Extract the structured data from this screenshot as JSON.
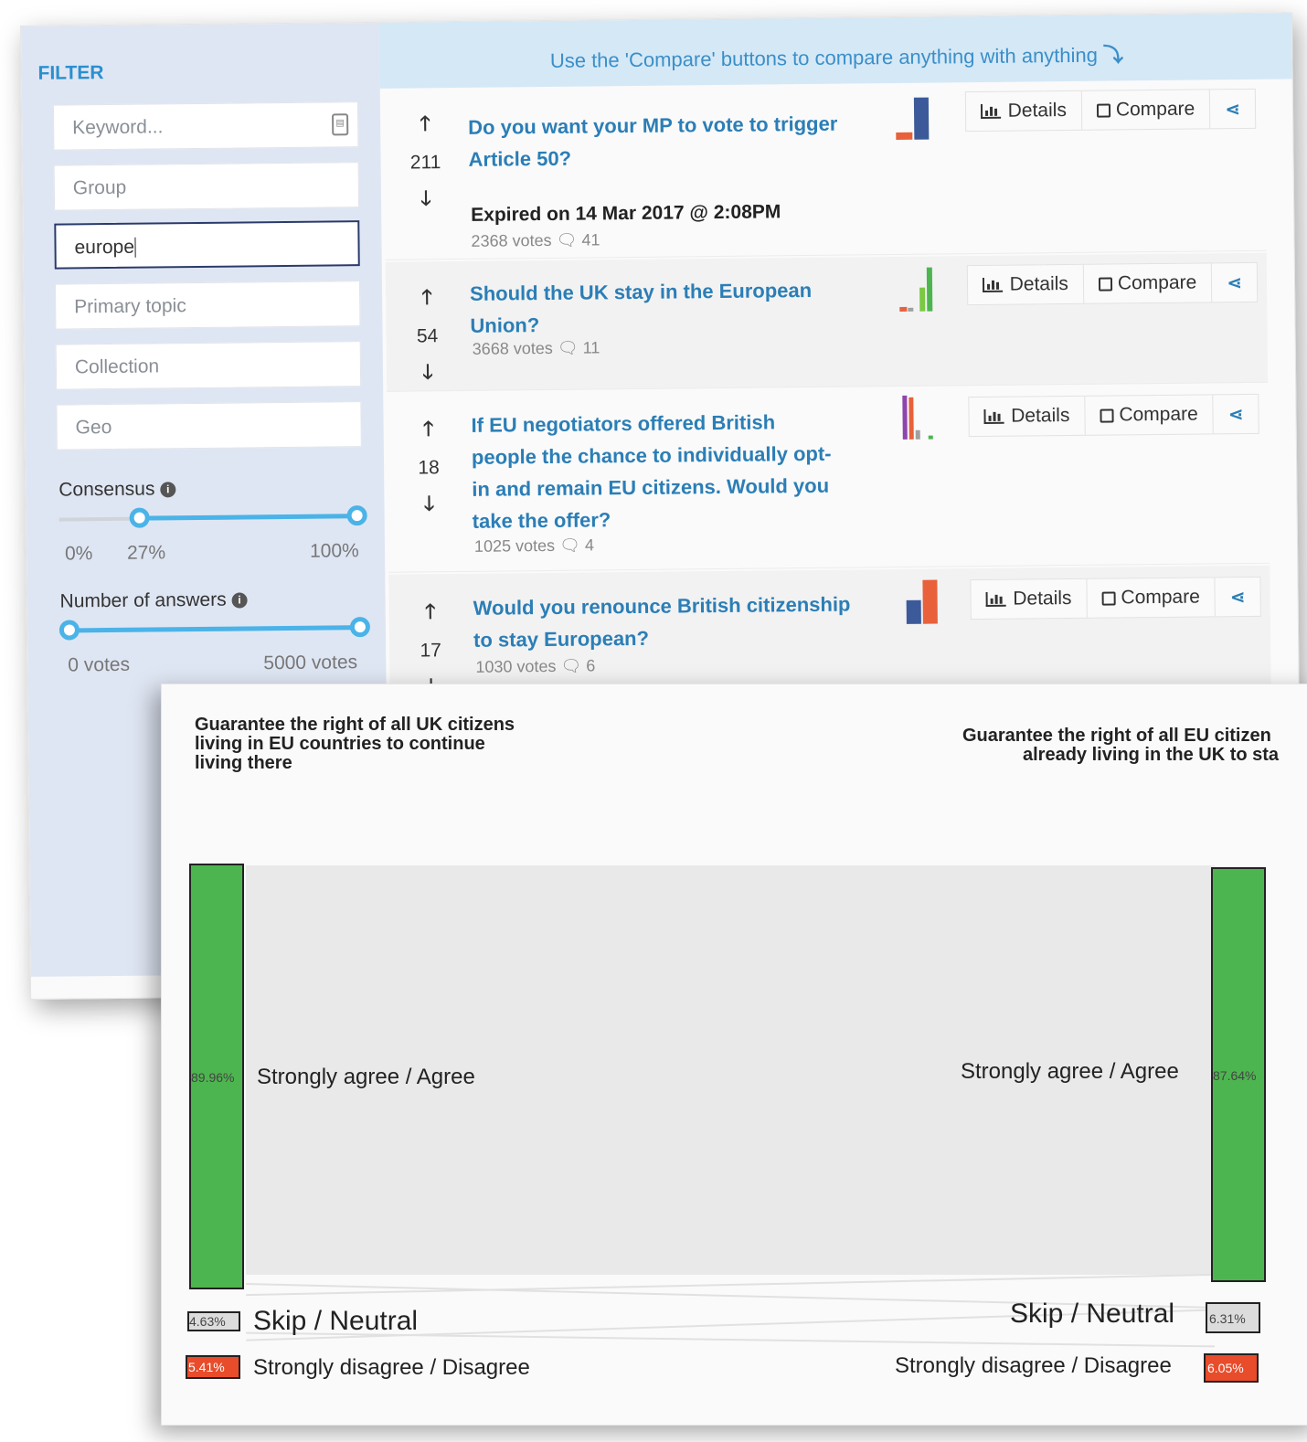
{
  "filter": {
    "title": "FILTER",
    "keyword_placeholder": "Keyword...",
    "group_placeholder": "Group",
    "search_value": "europe",
    "primary_topic_placeholder": "Primary topic",
    "collection_placeholder": "Collection",
    "geo_placeholder": "Geo",
    "consensus": {
      "label": "Consensus",
      "info_icon": "info-icon",
      "tick_min": "0%",
      "tick_low": "27%",
      "tick_max": "100%",
      "value_low": 27,
      "value_high": 100
    },
    "answers": {
      "label": "Number of answers",
      "info_icon": "info-icon",
      "tick_min": "0 votes",
      "tick_max": "5000 votes",
      "value_low": 0,
      "value_high": 5000
    }
  },
  "banner": {
    "text": "Use the 'Compare' buttons to compare anything with anything",
    "icon": "curved-arrow-down-icon",
    "arrow": "⤵"
  },
  "buttons": {
    "details": "Details",
    "compare": "Compare",
    "share_icon": "share-icon"
  },
  "questions": [
    {
      "score": "211",
      "title_line1": "Do you want your MP to vote to trigger",
      "title_line2": "Article 50?",
      "expired": "Expired on 14 Mar 2017 @ 2:08PM",
      "votes": "2368 votes",
      "comments": "41",
      "spark_colors": [
        "#e8613a",
        "#3c5a9a"
      ]
    },
    {
      "score": "54",
      "title_line1": "Should the UK stay in the European",
      "title_line2": "Union?",
      "votes": "3668 votes",
      "comments": "11",
      "spark_colors": [
        "#e8613a",
        "#a0a0a0",
        "#7ac943",
        "#4db54f"
      ]
    },
    {
      "score": "18",
      "title_line1": "If EU negotiators offered British",
      "title_line2": "people the chance to individually opt-",
      "title_line3": "in and remain EU citizens. Would you",
      "title_line4": "take the offer?",
      "votes": "1025 votes",
      "comments": "4",
      "spark_colors": [
        "#8e44ad",
        "#e8613a",
        "#a0a0a0",
        "#4db54f"
      ]
    },
    {
      "score": "17",
      "title_line1": "Would you renounce British citizenship",
      "title_line2": "to stay European?",
      "votes": "1030 votes",
      "comments": "6",
      "spark_colors": [
        "#3c5a9a",
        "#e8613a"
      ]
    }
  ],
  "comparison": {
    "left": {
      "title_line1": "Guarantee the right of all UK citizens",
      "title_line2": "living in EU countries to continue",
      "title_line3": "living there",
      "agree_pct": "89.96%",
      "neutral_pct": "4.63%",
      "disagree_pct": "5.41%"
    },
    "right": {
      "title_line1": "Guarantee the right of all EU citizen",
      "title_line2": "already living in the UK to sta",
      "agree_pct": "87.64%",
      "neutral_pct": "6.31%",
      "disagree_pct": "6.05%"
    },
    "labels": {
      "agree": "Strongly agree / Agree",
      "neutral": "Skip / Neutral",
      "disagree": "Strongly disagree / Disagree"
    },
    "colors": {
      "agree": "#4db54f",
      "neutral": "#dcdcdc",
      "disagree": "#e84c2b"
    }
  }
}
